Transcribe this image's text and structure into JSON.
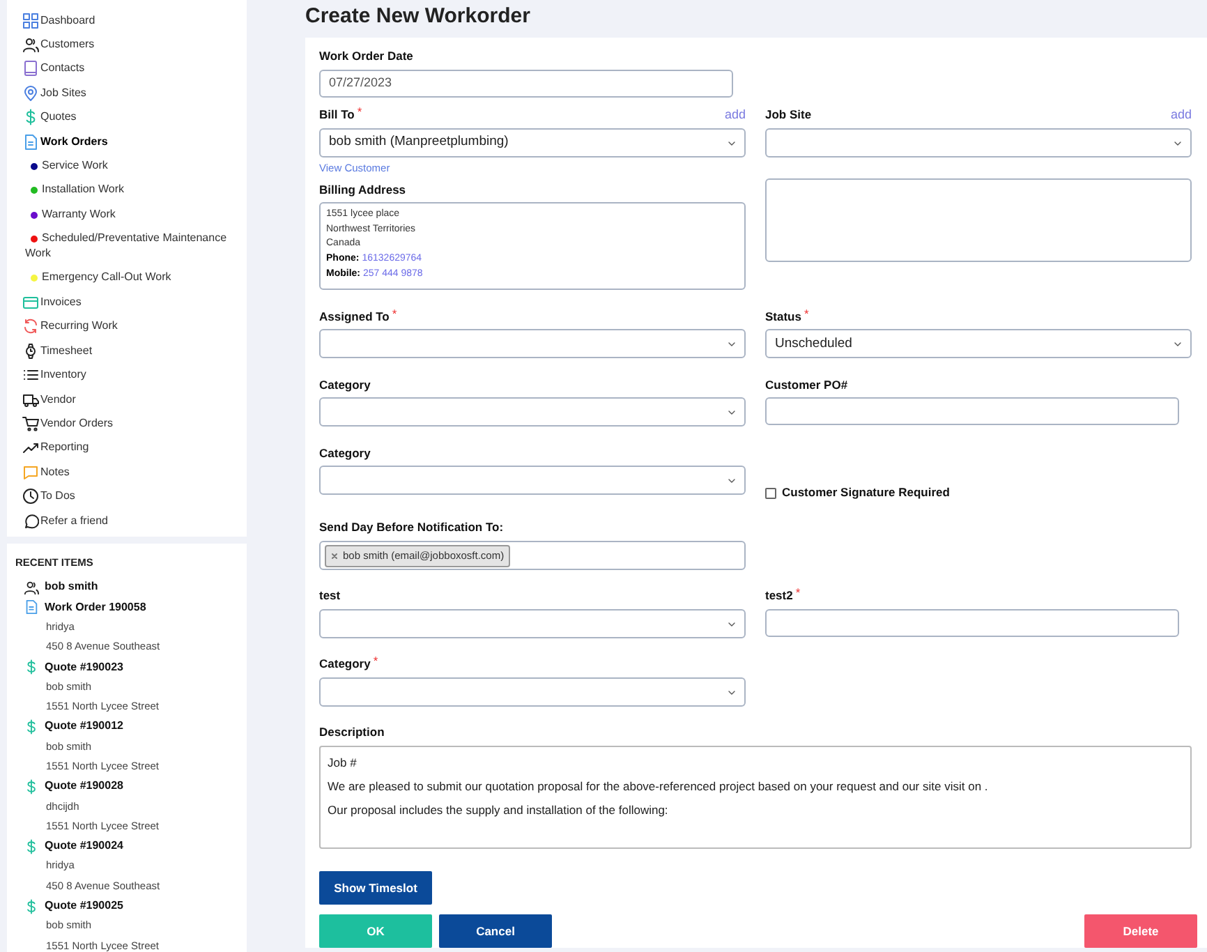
{
  "sidebar": {
    "items": [
      {
        "label": "Dashboard",
        "selected": false
      },
      {
        "label": "Customers",
        "selected": false
      },
      {
        "label": "Contacts",
        "selected": false
      },
      {
        "label": "Job Sites",
        "selected": false
      },
      {
        "label": "Quotes",
        "selected": false
      },
      {
        "label": "Work Orders",
        "selected": true,
        "children": [
          {
            "label": "Service Work",
            "color": "#0a0a8c"
          },
          {
            "label": "Installation Work",
            "color": "#22bb22"
          },
          {
            "label": "Warranty Work",
            "color": "#6a0dcc"
          },
          {
            "label": "Scheduled/Preventative Maintenance Work",
            "color": "#ee1111"
          },
          {
            "label": "Emergency Call-Out Work",
            "color": "#f5f542"
          }
        ]
      },
      {
        "label": "Invoices",
        "selected": false
      },
      {
        "label": "Recurring Work",
        "selected": false
      },
      {
        "label": "Timesheet",
        "selected": false
      },
      {
        "label": "Inventory",
        "selected": false
      },
      {
        "label": "Vendor",
        "selected": false
      },
      {
        "label": "Vendor Orders",
        "selected": false
      },
      {
        "label": "Reporting",
        "selected": false
      },
      {
        "label": "Notes",
        "selected": false
      },
      {
        "label": "To Dos",
        "selected": false
      },
      {
        "label": "Refer a friend",
        "selected": false
      }
    ]
  },
  "recent_items": {
    "title": "RECENT ITEMS",
    "items": [
      {
        "kind": "customer",
        "title": "bob smith"
      },
      {
        "kind": "work_order",
        "title": "Work Order 190058",
        "lines": [
          "hridya",
          "450 8 Avenue Southeast"
        ]
      },
      {
        "kind": "quote",
        "title": "Quote #190023",
        "lines": [
          "bob smith",
          "1551 North Lycee Street"
        ]
      },
      {
        "kind": "quote",
        "title": "Quote #190012",
        "lines": [
          "bob smith",
          "1551 North Lycee Street"
        ]
      },
      {
        "kind": "quote",
        "title": "Quote #190028",
        "lines": [
          "dhcijdh",
          "1551 North Lycee Street"
        ]
      },
      {
        "kind": "quote",
        "title": "Quote #190024",
        "lines": [
          "hridya",
          "450 8 Avenue Southeast"
        ]
      },
      {
        "kind": "quote",
        "title": "Quote #190025",
        "lines": [
          "bob smith",
          "1551 North Lycee Street"
        ]
      }
    ]
  },
  "page_title": "Create New Workorder",
  "form": {
    "rows": [
      {
        "left": [
          {
            "kind": "input",
            "label": "Work Order Date",
            "value": "07/27/2023"
          }
        ],
        "right": []
      },
      {
        "left": [
          {
            "kind": "select",
            "label": "Bill To",
            "required_mark": "*",
            "add_link": "add",
            "value": "bob smith (Manpreetplumbing)",
            "link": "View Customer"
          },
          {
            "kind": "address",
            "label": "Billing Address",
            "lines": [
              {
                "text": "1551 lycee place"
              },
              {
                "text": "Northwest Territories"
              },
              {
                "text": "Canada"
              },
              {
                "label": "Phone:",
                "value": "16132629764"
              },
              {
                "label": "Mobile:",
                "value": "257 444 9878"
              }
            ]
          }
        ],
        "right": [
          {
            "kind": "select",
            "label": "Job Site",
            "add_link": "add"
          },
          {
            "kind": "textarea"
          }
        ]
      },
      {
        "left": [
          {
            "kind": "select",
            "label": "Assigned To",
            "required_mark": "*"
          }
        ],
        "right": [
          {
            "kind": "select",
            "label": "Status",
            "required_mark": "*",
            "value": "Unscheduled"
          }
        ]
      },
      {
        "left": [
          {
            "kind": "select",
            "label": "Category"
          }
        ],
        "right": [
          {
            "kind": "input",
            "label": "Customer PO#"
          }
        ]
      },
      {
        "left": [
          {
            "kind": "select",
            "label": "Category"
          }
        ],
        "right": [
          {
            "kind": "checkbox",
            "label": "Customer Signature Required",
            "checked": false
          }
        ]
      },
      {
        "left": [
          {
            "kind": "tags",
            "label": "Send Day Before Notification To:",
            "tags": [
              "bob smith (email@jobboxosft.com)"
            ]
          }
        ],
        "right": []
      },
      {
        "left": [
          {
            "kind": "select",
            "label": "test"
          }
        ],
        "right": [
          {
            "kind": "input",
            "label": "test2",
            "required_mark": "*"
          }
        ]
      },
      {
        "left": [
          {
            "kind": "select",
            "label": "Category",
            "required_mark": "*"
          }
        ],
        "right": []
      },
      {
        "full": [
          {
            "kind": "description",
            "label": "Description",
            "paragraphs": [
              "Job #",
              "We are pleased to submit our quotation proposal for the above-referenced project based on your request and our site visit on .",
              "Our proposal includes the supply and installation of the following:"
            ]
          }
        ]
      }
    ]
  },
  "timeslot_button": {
    "label": "Show Timeslot",
    "kind": "primary"
  },
  "actions": [
    {
      "label": "OK",
      "kind": "success"
    },
    {
      "label": "Cancel",
      "kind": "primary"
    },
    {
      "label": "Delete",
      "kind": "danger"
    }
  ]
}
